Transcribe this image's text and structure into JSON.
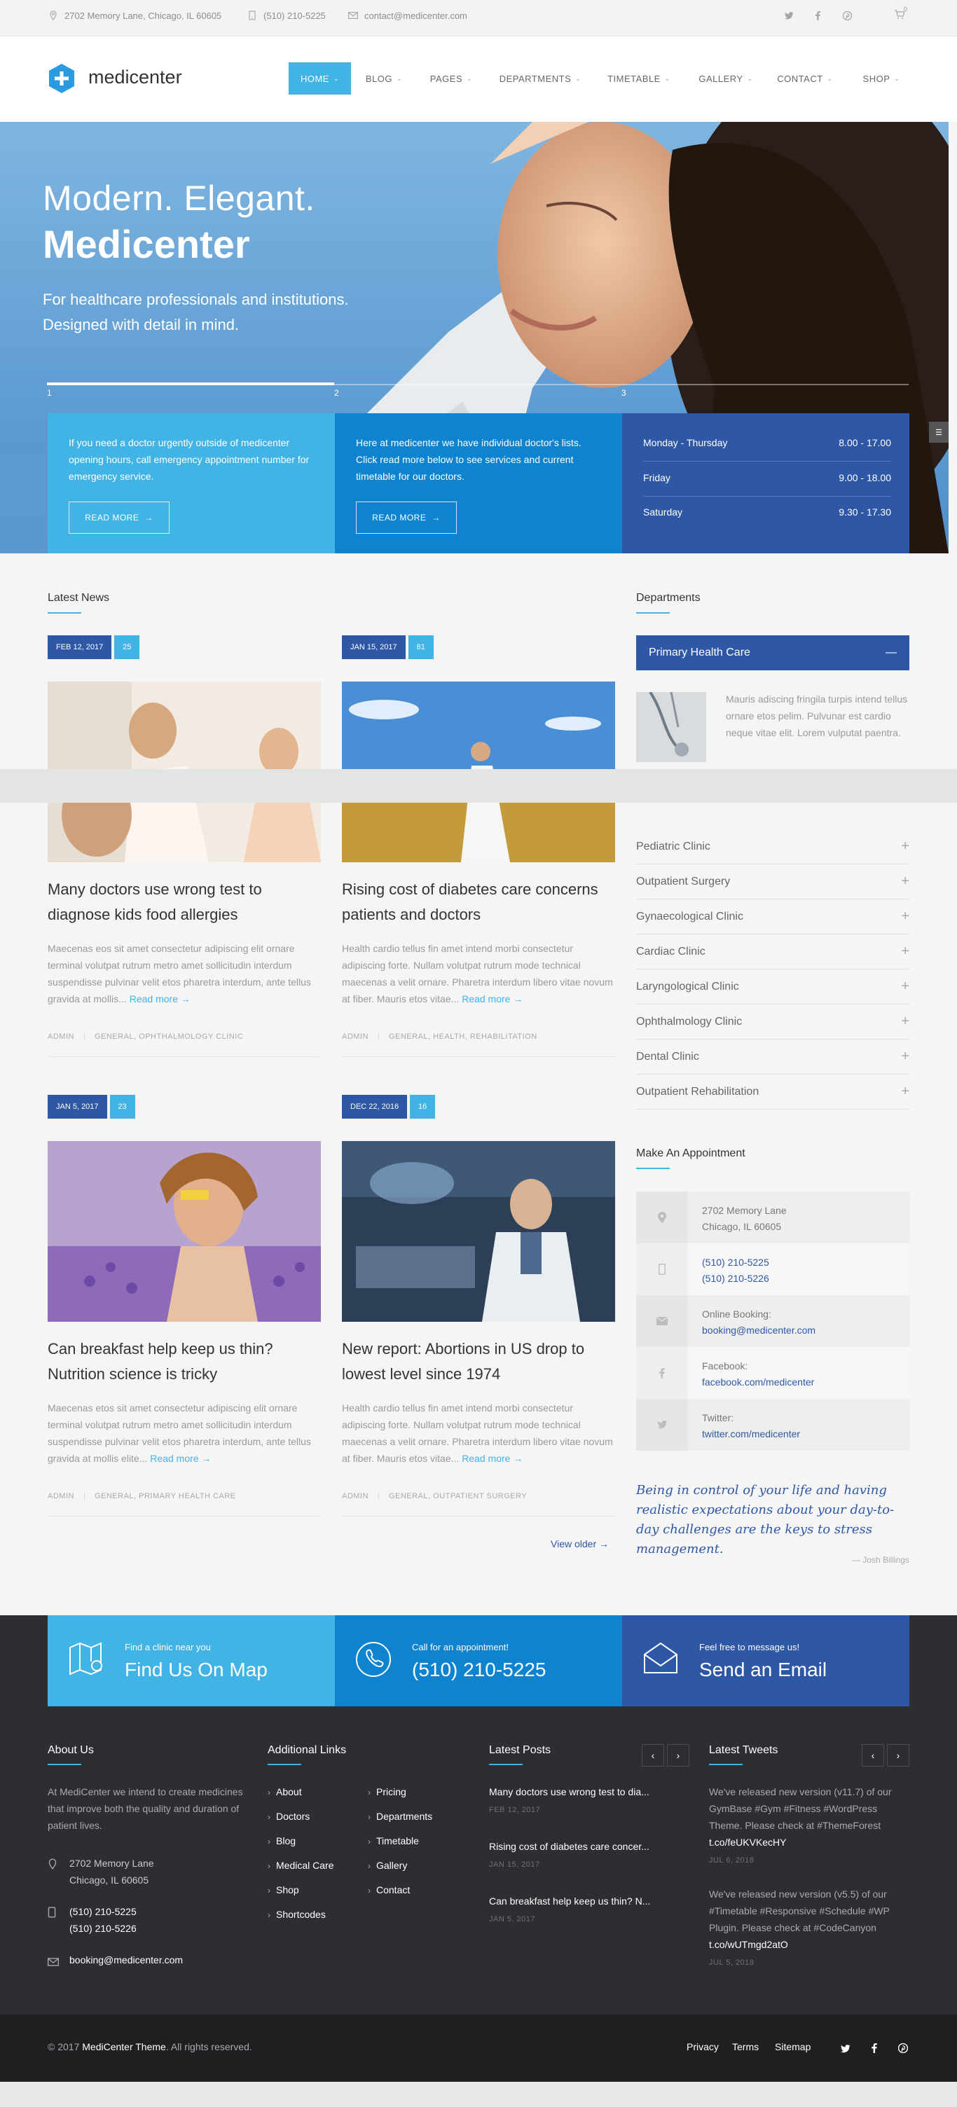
{
  "topbar": {
    "address": "2702 Memory Lane, Chicago, IL 60605",
    "phone": "(510) 210-5225",
    "email": "contact@medicenter.com",
    "cart_count": "0"
  },
  "header": {
    "logo": "medicenter",
    "nav": [
      "HOME",
      "BLOG",
      "PAGES",
      "DEPARTMENTS",
      "TIMETABLE",
      "GALLERY",
      "CONTACT",
      "SHOP"
    ]
  },
  "hero": {
    "line1": "Modern. Elegant.",
    "line2": "Medicenter",
    "sub1": "For healthcare professionals and institutions.",
    "sub2": "Designed with detail in mind.",
    "slides": [
      "1",
      "2",
      "3"
    ]
  },
  "info_boxes": [
    {
      "text": "If you need a doctor urgently outside of medicenter opening hours, call emergency appointment number for emergency service.",
      "button": "READ MORE"
    },
    {
      "text": "Here at medicenter we have individual doctor's lists. Click read more below to see services and current timetable for our doctors.",
      "button": "READ MORE"
    }
  ],
  "hours": [
    {
      "day": "Monday - Thursday",
      "time": "8.00 - 17.00"
    },
    {
      "day": "Friday",
      "time": "9.00 - 18.00"
    },
    {
      "day": "Saturday",
      "time": "9.30 - 17.30"
    }
  ],
  "news": {
    "title": "Latest News",
    "posts": [
      {
        "date": "FEB 12, 2017",
        "comments": "25",
        "title1": "Many doctors use wrong test to",
        "title2": "diagnose kids food allergies",
        "text": "Maecenas eos sit amet consectetur adipiscing elit ornare terminal volutpat rutrum metro amet sollicitudin interdum suspendisse pulvinar velit etos pharetra interdum, ante tellus gravida at mollis...",
        "readmore": "Read more",
        "author": "ADMIN",
        "cats": "GENERAL,   OPHTHALMOLOGY CLINIC"
      },
      {
        "date": "JAN 15, 2017",
        "comments": "81",
        "title1": "Rising cost of diabetes care concerns",
        "title2": "patients and doctors",
        "text": "Health cardio tellus fin amet intend morbi consectetur adipiscing forte. Nullam volutpat rutrum mode technical maecenas a velit ornare. Pharetra interdum libero vitae novum at fiber. Mauris etos vitae...",
        "readmore": "Read more",
        "author": "ADMIN",
        "cats": "GENERAL,   HEALTH,   REHABILITATION"
      },
      {
        "date": "JAN 5, 2017",
        "comments": "23",
        "title1": "Can breakfast help keep us thin?",
        "title2": "Nutrition science is tricky",
        "text": "Maecenas etos sit amet consectetur adipiscing elit ornare terminal volutpat rutrum metro amet sollicitudin interdum suspendisse pulvinar velit etos pharetra interdum, ante tellus gravida at mollis elite...",
        "readmore": "Read more",
        "author": "ADMIN",
        "cats": "GENERAL,   PRIMARY HEALTH CARE"
      },
      {
        "date": "DEC 22, 2016",
        "comments": "16",
        "title1": "New report: Abortions in US drop to",
        "title2": "lowest level since 1974",
        "text": "Health cardio tellus fin amet intend morbi consectetur adipiscing forte. Nullam volutpat rutrum mode technical maecenas a velit ornare. Pharetra interdum libero vitae novum at fiber. Mauris etos vitae...",
        "readmore": "Read more",
        "author": "ADMIN",
        "cats": "GENERAL,   OUTPATIENT SURGERY"
      }
    ],
    "view_older": "View older"
  },
  "departments": {
    "title": "Departments",
    "active": "Primary Health Care",
    "active_text": "Mauris adiscing fringila turpis intend tellus ornare etos pelim. Pulvunar est cardio neque vitae elit. Lorem vulputat paentra.",
    "items": [
      "Pediatric Clinic",
      "Outpatient Surgery",
      "Gynaecological Clinic",
      "Cardiac Clinic",
      "Laryngological Clinic",
      "Ophthalmology Clinic",
      "Dental Clinic",
      "Outpatient Rehabilitation"
    ]
  },
  "appointment": {
    "title": "Make An Appointment",
    "addr1": "2702 Memory Lane",
    "addr2": "Chicago, IL 60605",
    "phone1": "(510) 210-5225",
    "phone2": "(510) 210-5226",
    "booking_label": "Online Booking:",
    "booking": "booking@medicenter.com",
    "fb_label": "Facebook:",
    "fb": "facebook.com/medicenter",
    "tw_label": "Twitter:",
    "tw": "twitter.com/medicenter"
  },
  "quote": {
    "text": "Being in control of your life and having realistic expectations about your day-to-day challenges are the keys to stress management.",
    "author": "— Josh Billings"
  },
  "cta": [
    {
      "small": "Find a clinic near you",
      "big": "Find Us On Map",
      "color": "#42b3e5"
    },
    {
      "small": "Call for an appointment!",
      "big": "(510) 210-5225",
      "color": "#0e83d0"
    },
    {
      "small": "Feel free to message us!",
      "big": "Send an Email",
      "color": "#2e58a6"
    }
  ],
  "footer": {
    "about_title": "About Us",
    "about_text": "At MediCenter we intend to create medicines that improve both the quality and duration of patient lives.",
    "addr1": "2702 Memory Lane",
    "addr2": "Chicago, IL 60605",
    "phone1": "(510) 210-5225",
    "phone2": "(510) 210-5226",
    "email": "booking@medicenter.com",
    "links_title": "Additional Links",
    "links_col1": [
      "About",
      "Doctors",
      "Blog",
      "Medical Care",
      "Shop",
      "Shortcodes"
    ],
    "links_col2": [
      "Pricing",
      "Departments",
      "Timetable",
      "Gallery",
      "Contact"
    ],
    "posts_title": "Latest Posts",
    "posts": [
      {
        "title": "Many doctors use wrong test to dia...",
        "date": "FEB 12, 2017"
      },
      {
        "title": "Rising cost of diabetes care concer...",
        "date": "JAN 15, 2017"
      },
      {
        "title": "Can breakfast help keep us thin? N...",
        "date": "JAN 5, 2017"
      }
    ],
    "tweets_title": "Latest Tweets",
    "tweets": [
      {
        "l1": "We've released new version (v11.7) of our",
        "l2": "GymBase #Gym #Fitness #WordPress",
        "l3": "Theme. Please check at #ThemeForest",
        "link": "t.co/feUKVKecHY",
        "date": "JUL 6, 2018"
      },
      {
        "l1": "We've released new version (v5.5) of our",
        "l2": "#Timetable #Responsive #Schedule #WP",
        "l3": "Plugin. Please check at #CodeCanyon",
        "link": "t.co/wUTmgd2atO",
        "date": "JUL 5, 2018"
      }
    ]
  },
  "bottom": {
    "copy_prefix": "© 2017 ",
    "copy_brand": "MediCenter Theme",
    "copy_suffix": ". All rights reserved.",
    "links": [
      "Privacy",
      "Terms",
      "Sitemap"
    ]
  }
}
